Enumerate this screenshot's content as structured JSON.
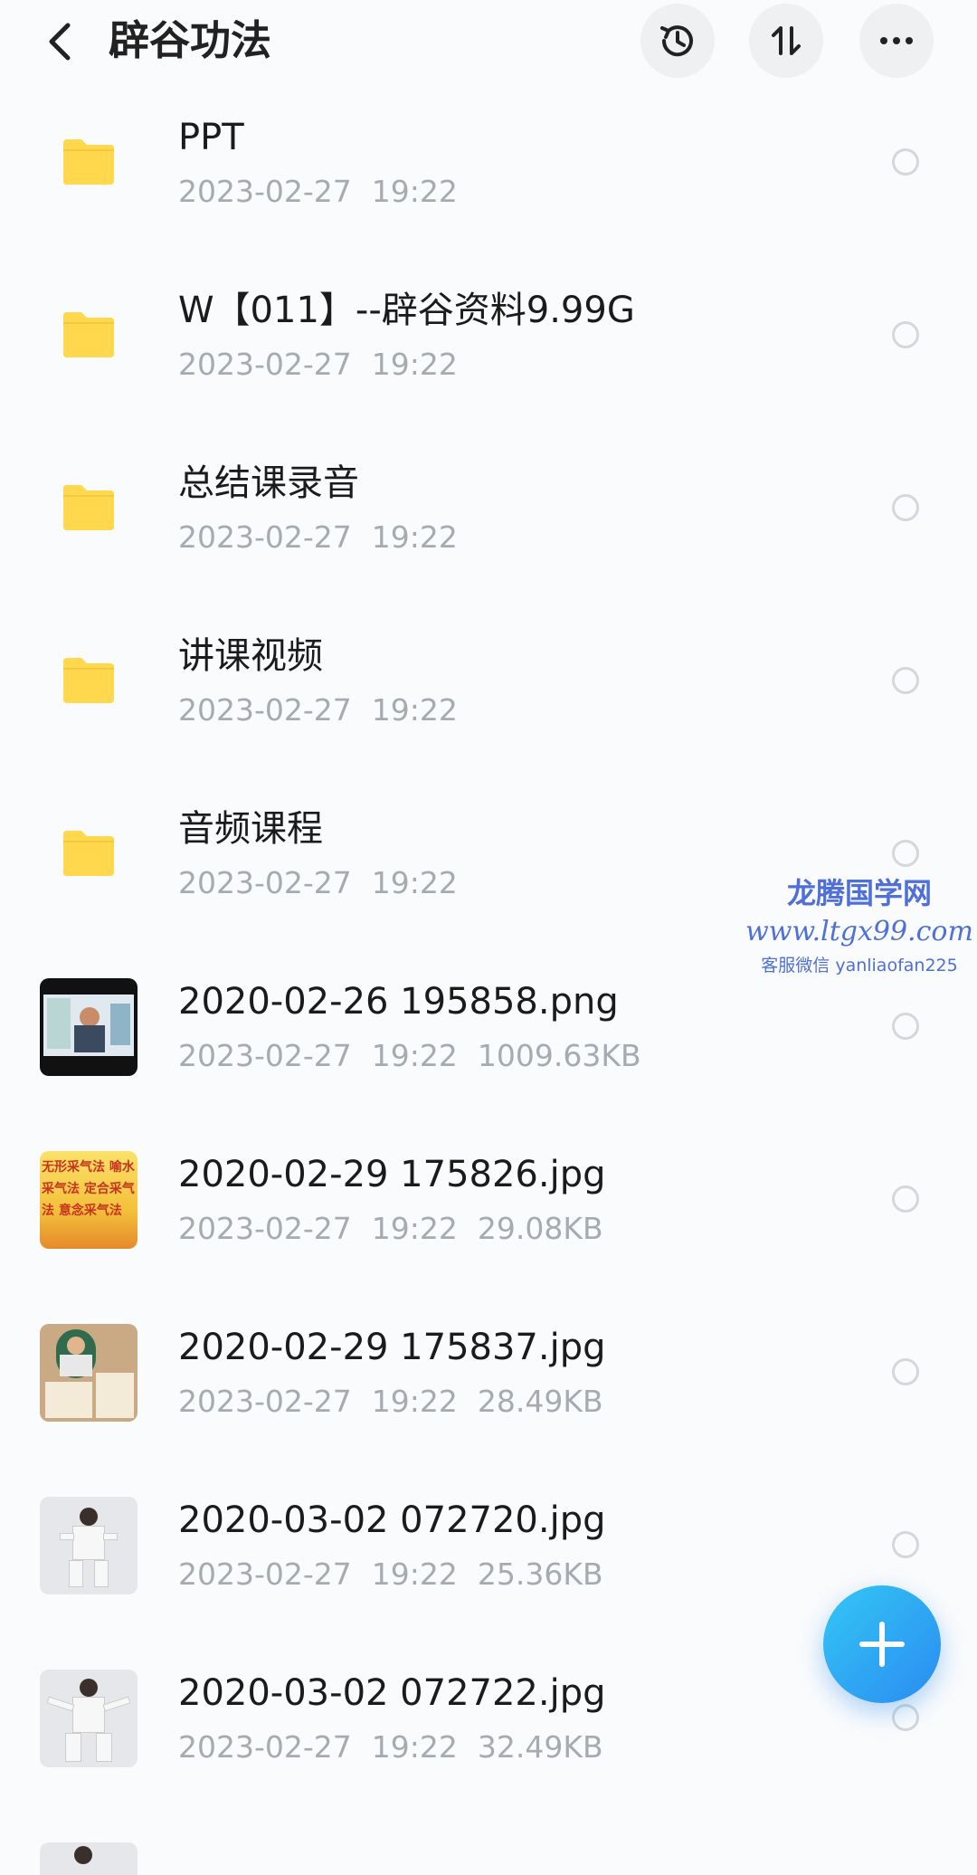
{
  "header": {
    "title": "辟谷功法",
    "back_icon": "back-arrow-icon",
    "history_icon": "history-icon",
    "sort_icon": "sort-icon",
    "more_icon": "more-icon"
  },
  "items": [
    {
      "type": "folder",
      "name": "PPT",
      "date": "2023-02-27",
      "time": "19:22",
      "size": ""
    },
    {
      "type": "folder",
      "name": "W【011】--辟谷资料9.99G",
      "date": "2023-02-27",
      "time": "19:22",
      "size": ""
    },
    {
      "type": "folder",
      "name": "总结课录音",
      "date": "2023-02-27",
      "time": "19:22",
      "size": ""
    },
    {
      "type": "folder",
      "name": "讲课视频",
      "date": "2023-02-27",
      "time": "19:22",
      "size": ""
    },
    {
      "type": "folder",
      "name": "音频课程",
      "date": "2023-02-27",
      "time": "19:22",
      "size": ""
    },
    {
      "type": "image",
      "name": "2020-02-26 195858.png",
      "date": "2023-02-27",
      "time": "19:22",
      "size": "1009.63KB"
    },
    {
      "type": "image",
      "name": "2020-02-29 175826.jpg",
      "date": "2023-02-27",
      "time": "19:22",
      "size": "29.08KB"
    },
    {
      "type": "image",
      "name": "2020-02-29 175837.jpg",
      "date": "2023-02-27",
      "time": "19:22",
      "size": "28.49KB"
    },
    {
      "type": "image",
      "name": "2020-03-02 072720.jpg",
      "date": "2023-02-27",
      "time": "19:22",
      "size": "25.36KB"
    },
    {
      "type": "image",
      "name": "2020-03-02 072722.jpg",
      "date": "2023-02-27",
      "time": "19:22",
      "size": "32.49KB"
    }
  ],
  "watermark": {
    "line1": "龙腾国学网",
    "line2": "www.ltgx99.com",
    "line3": "客服微信 yanliaofan225"
  },
  "thumb_text": {
    "t2": "无形采气法 喻水采气法 定合采气法 意念采气法"
  },
  "fab_icon": "plus-icon",
  "colors": {
    "folder": "#ffd84d",
    "fab": "#2b8bf2",
    "meta_text": "#a6abb2",
    "watermark": "#4f6fd9"
  }
}
